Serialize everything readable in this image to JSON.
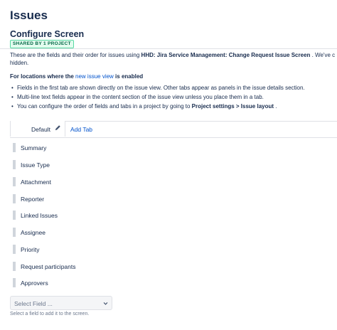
{
  "page": {
    "title": "Issues"
  },
  "screen": {
    "section_title": "Configure Screen",
    "shared_badge": "SHARED BY 1 PROJECT",
    "intro_prefix": "These are the fields and their order for issues using ",
    "intro_screen": "HHD: Jira Service Management: Change Request Issue Screen",
    "intro_suffix": " . We've c",
    "intro_cont": "hidden."
  },
  "locations": {
    "heading_prefix": "For locations where the ",
    "heading_link": "new issue view",
    "heading_suffix": " is enabled",
    "bullet_1": "Fields in the first tab are shown directly on the issue view. Other tabs appear as panels in the issue details section.",
    "bullet_2": "Multi-line text fields appear in the content section of the issue view unless you place them in a tab.",
    "bullet_3_prefix": "You can configure the order of fields and tabs in a project by going to ",
    "bullet_3_bold": "Project settings > Issue layout",
    "bullet_3_suffix": " ."
  },
  "tabs": {
    "default_label": "Default",
    "add_label": "Add Tab"
  },
  "fields": [
    "Summary",
    "Issue Type",
    "Attachment",
    "Reporter",
    "Linked Issues",
    "Assignee",
    "Priority",
    "Request participants",
    "Approvers"
  ],
  "select": {
    "placeholder": "Select Field ...",
    "help": "Select a field to add it to the screen."
  },
  "colors": {
    "link": "#0052cc",
    "text": "#172b4d",
    "muted": "#6b778c",
    "badge_border": "#57d9a3",
    "badge_text": "#006644"
  },
  "icons": {
    "edit_tab": "pencil-icon",
    "drag": "drag-handle-icon",
    "dropdown": "chevron-down-icon"
  }
}
